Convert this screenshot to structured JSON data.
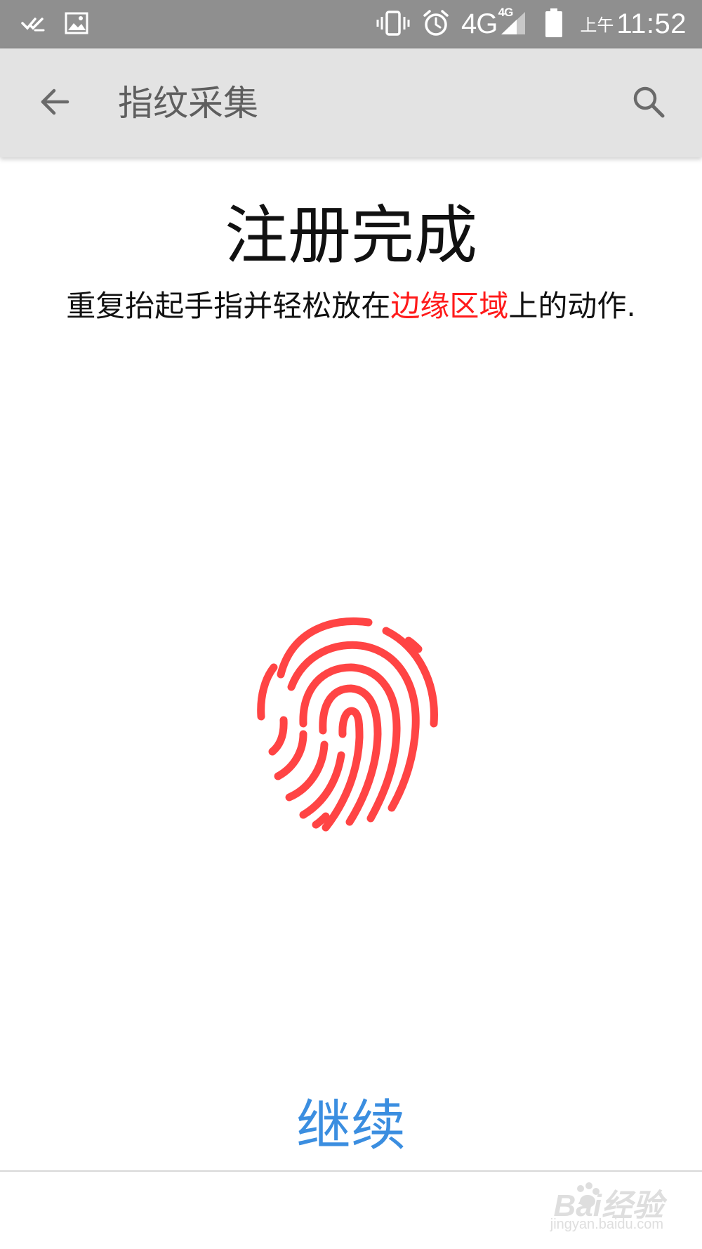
{
  "status_bar": {
    "network": "4G",
    "network_sup": "4G",
    "time_ampm": "上午",
    "time": "11:52"
  },
  "app_bar": {
    "title": "指纹采集"
  },
  "content": {
    "heading": "注册完成",
    "instruction_before": "重复抬起手指并轻松放在",
    "instruction_highlight": "边缘区域",
    "instruction_after": "上的动作.",
    "highlight_color": "#ff1a1a",
    "fingerprint_color": "#ff4444"
  },
  "footer": {
    "continue_label": "继续",
    "continue_color": "#3b8ee0"
  },
  "watermark": {
    "main": "Bai经验",
    "sub": "jingyan.baidu.com"
  },
  "icons": {
    "status_left": [
      "check-done-icon",
      "image-icon"
    ],
    "status_right": [
      "vibrate-icon",
      "alarm-icon",
      "signal-icon",
      "battery-icon"
    ],
    "app_bar": [
      "back-arrow-icon",
      "search-icon"
    ],
    "content": [
      "fingerprint-icon"
    ]
  }
}
